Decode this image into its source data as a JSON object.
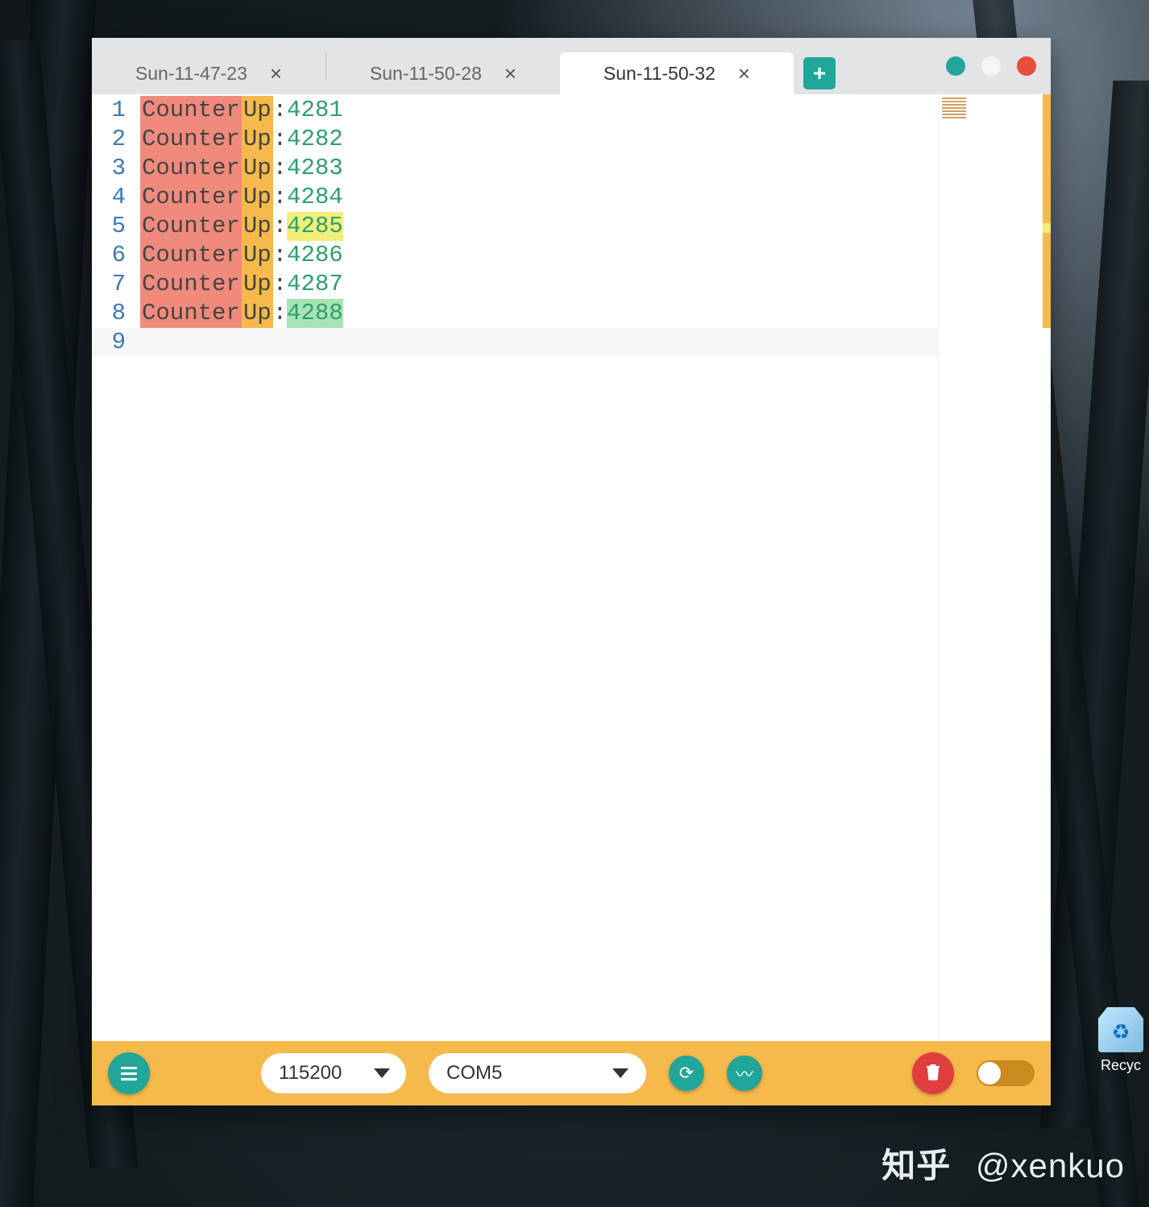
{
  "tabs": [
    {
      "label": "Sun-11-47-23",
      "active": false
    },
    {
      "label": "Sun-11-50-28",
      "active": false
    },
    {
      "label": "Sun-11-50-32",
      "active": true
    }
  ],
  "editor": {
    "token_counter": "Counter",
    "token_up": "Up",
    "colon": ":",
    "lines": [
      {
        "n": "1",
        "val": "4281",
        "hl": ""
      },
      {
        "n": "2",
        "val": "4282",
        "hl": ""
      },
      {
        "n": "3",
        "val": "4283",
        "hl": ""
      },
      {
        "n": "4",
        "val": "4284",
        "hl": ""
      },
      {
        "n": "5",
        "val": "4285",
        "hl": "yellow"
      },
      {
        "n": "6",
        "val": "4286",
        "hl": ""
      },
      {
        "n": "7",
        "val": "4287",
        "hl": ""
      },
      {
        "n": "8",
        "val": "4288",
        "hl": "green"
      }
    ],
    "empty_line_n": "9"
  },
  "toolbar": {
    "baud": "115200",
    "port": "COM5"
  },
  "desktop": {
    "recycle_label": "Recyc"
  },
  "watermark": {
    "prefix": "知乎",
    "handle": "@xenkuo"
  },
  "colors": {
    "accent_teal": "#22a699",
    "accent_amber": "#f6b94b",
    "danger": "#e03e3e"
  }
}
